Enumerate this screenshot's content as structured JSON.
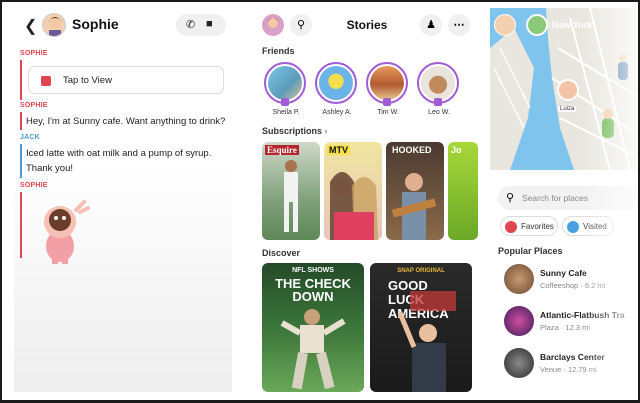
{
  "chat": {
    "title": "Sophie",
    "back_icon": "chevron-left-icon",
    "messages": [
      {
        "sender": "SOPHIE",
        "text": "Tap to View"
      },
      {
        "sender": "SOPHIE",
        "text": "Hey, I'm at Sunny cafe. Want anything to drink?"
      },
      {
        "sender": "JACK",
        "text": "Iced latte with oat milk and a pump of syrup. Thank you!"
      },
      {
        "sender": "SOPHIE",
        "text": ""
      }
    ],
    "colors": {
      "sophie": "#e1454e",
      "jack": "#4a9ad6"
    }
  },
  "stories": {
    "title": "Stories",
    "friends_label": "Friends",
    "friends": [
      {
        "name": "Sheila P."
      },
      {
        "name": "Ashley A."
      },
      {
        "name": "Tim W."
      },
      {
        "name": "Leo W."
      }
    ],
    "subscriptions_label": "Subscriptions",
    "subscriptions": [
      {
        "tag": "Esquire"
      },
      {
        "tag": "MTV"
      },
      {
        "tag": "HOOKED"
      },
      {
        "tag": "Jo"
      }
    ],
    "discover_label": "Discover",
    "discover": [
      {
        "top": "NFL SHOWS",
        "title": "THE CHECK DOWN"
      },
      {
        "top": "SNAP ORIGINAL",
        "title": "GOOD LUCK AMERICA"
      }
    ]
  },
  "map": {
    "city": "New York",
    "pin_label": "Luiza",
    "search_placeholder": "Search for places",
    "chips": [
      {
        "label": "Favorites"
      },
      {
        "label": "Visited"
      }
    ],
    "popular_title": "Popular Places",
    "places": [
      {
        "name": "Sunny Cafe",
        "info": "Coffeeshop · 6.2 mi"
      },
      {
        "name": "Atlantic-Flatbush Tra",
        "info": "Plaza · 12.3 mi"
      },
      {
        "name": "Barclays Center",
        "info": "Venue · 12.79 mi"
      }
    ]
  }
}
